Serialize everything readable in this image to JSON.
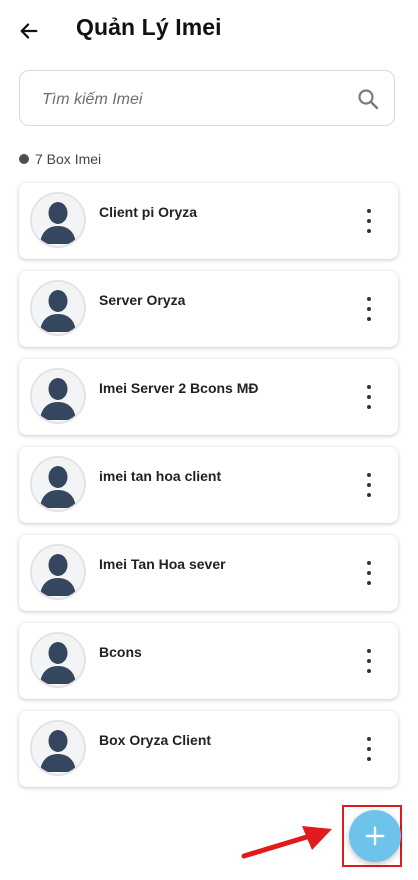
{
  "header": {
    "title": "Quản Lý Imei"
  },
  "search": {
    "placeholder": "Tìm kiếm Imei",
    "value": ""
  },
  "list_count": "7 Box Imei",
  "items": [
    {
      "name": "Client pi Oryza"
    },
    {
      "name": "Server Oryza"
    },
    {
      "name": "Imei Server 2 Bcons MĐ"
    },
    {
      "name": "imei tan hoa client"
    },
    {
      "name": "Imei Tan Hoa sever"
    },
    {
      "name": "Bcons"
    },
    {
      "name": "Box Oryza Client"
    }
  ],
  "icons": {
    "back": "arrow-left-icon",
    "search": "search-icon",
    "more": "more-vertical-icon",
    "avatar": "person-silhouette-icon",
    "add": "plus-icon"
  },
  "colors": {
    "fab": "#6dc3ea",
    "highlight": "#e01b1b",
    "avatar_figure": "#34475f"
  }
}
